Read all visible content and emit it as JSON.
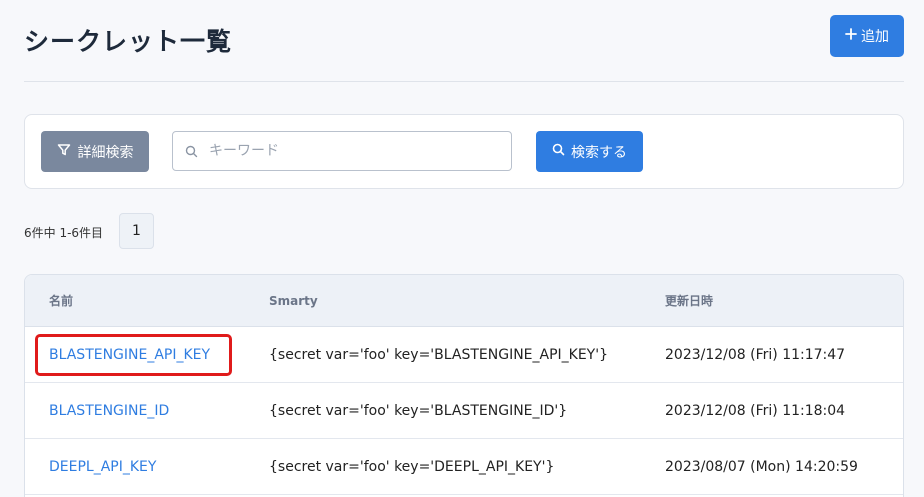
{
  "header": {
    "title": "シークレット一覧",
    "add_label": "追加",
    "add_icon": "plus-icon"
  },
  "search": {
    "filter_label": "詳細検索",
    "placeholder": "キーワード",
    "value": "",
    "search_label": "検索する"
  },
  "pagination": {
    "summary": "6件中 1-6件目",
    "current_page": "1"
  },
  "table": {
    "columns": [
      "名前",
      "Smarty",
      "更新日時"
    ],
    "rows": [
      {
        "name": "BLASTENGINE_API_KEY",
        "smarty": "{secret var='foo' key='BLASTENGINE_API_KEY'}",
        "updated": "2023/12/08 (Fri) 11:17:47"
      },
      {
        "name": "BLASTENGINE_ID",
        "smarty": "{secret var='foo' key='BLASTENGINE_ID'}",
        "updated": "2023/12/08 (Fri) 11:18:04"
      },
      {
        "name": "DEEPL_API_KEY",
        "smarty": "{secret var='foo' key='DEEPL_API_KEY'}",
        "updated": "2023/08/07 (Mon) 14:20:59"
      }
    ]
  },
  "colors": {
    "accent": "#2f7de1",
    "filter_button": "#7a889e",
    "highlight": "#e01b1b"
  }
}
